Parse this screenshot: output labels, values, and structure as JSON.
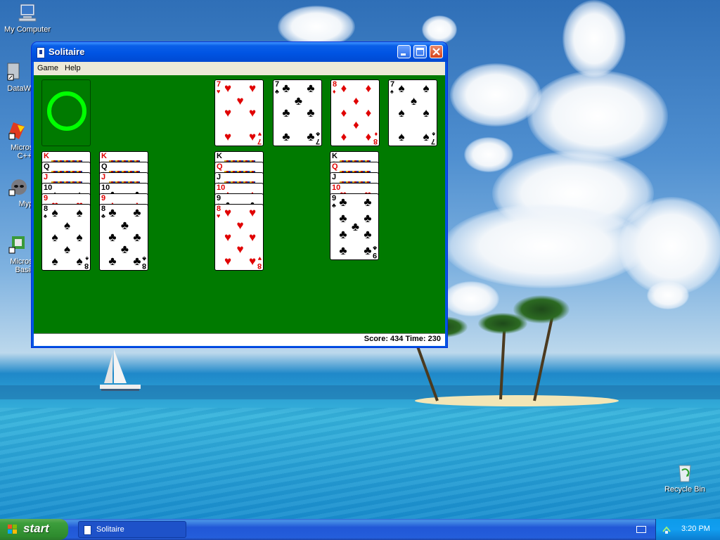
{
  "desktop": {
    "icons": [
      {
        "label": "My Computer"
      },
      {
        "label": "DataWa"
      },
      {
        "label": "Microsof C++"
      },
      {
        "label": "Myp"
      },
      {
        "label": "Microsof Basic"
      },
      {
        "label": "Recycle Bin"
      }
    ]
  },
  "window": {
    "title": "Solitaire",
    "menu": {
      "game": "Game",
      "help": "Help"
    },
    "status": "Score: 434 Time: 230"
  },
  "foundations": [
    {
      "rank": "7",
      "suit": "♥",
      "color": "red"
    },
    {
      "rank": "7",
      "suit": "♣",
      "color": "black"
    },
    {
      "rank": "8",
      "suit": "♦",
      "color": "red"
    },
    {
      "rank": "7",
      "suit": "♠",
      "color": "black"
    }
  ],
  "tableau": [
    {
      "stack": [
        {
          "rank": "K",
          "suit": "♥",
          "color": "red"
        },
        {
          "rank": "Q",
          "suit": "♠",
          "color": "black"
        },
        {
          "rank": "J",
          "suit": "♥",
          "color": "red"
        },
        {
          "rank": "10",
          "suit": "♠",
          "color": "black"
        },
        {
          "rank": "9",
          "suit": "♥",
          "color": "red"
        },
        {
          "rank": "8",
          "suit": "♠",
          "color": "black"
        }
      ]
    },
    {
      "stack": [
        {
          "rank": "K",
          "suit": "♦",
          "color": "red"
        },
        {
          "rank": "Q",
          "suit": "♣",
          "color": "black"
        },
        {
          "rank": "J",
          "suit": "♦",
          "color": "red"
        },
        {
          "rank": "10",
          "suit": "♣",
          "color": "black"
        },
        {
          "rank": "9",
          "suit": "♦",
          "color": "red"
        },
        {
          "rank": "8",
          "suit": "♣",
          "color": "black"
        }
      ]
    },
    {
      "stack": [
        {
          "rank": "K",
          "suit": "♠",
          "color": "black"
        },
        {
          "rank": "Q",
          "suit": "♦",
          "color": "red"
        },
        {
          "rank": "J",
          "suit": "♣",
          "color": "black"
        },
        {
          "rank": "10",
          "suit": "♦",
          "color": "red"
        },
        {
          "rank": "9",
          "suit": "♣",
          "color": "black"
        },
        {
          "rank": "8",
          "suit": "♥",
          "color": "red"
        }
      ]
    },
    {
      "stack": []
    },
    {
      "stack": [
        {
          "rank": "K",
          "suit": "♣",
          "color": "black"
        },
        {
          "rank": "Q",
          "suit": "♥",
          "color": "red"
        },
        {
          "rank": "J",
          "suit": "♠",
          "color": "black"
        },
        {
          "rank": "10",
          "suit": "♥",
          "color": "red"
        },
        {
          "rank": "9",
          "suit": "♣",
          "color": "black"
        }
      ]
    }
  ],
  "taskbar": {
    "start_label": "start",
    "task_label": "Solitaire",
    "clock": "3:20 PM"
  }
}
